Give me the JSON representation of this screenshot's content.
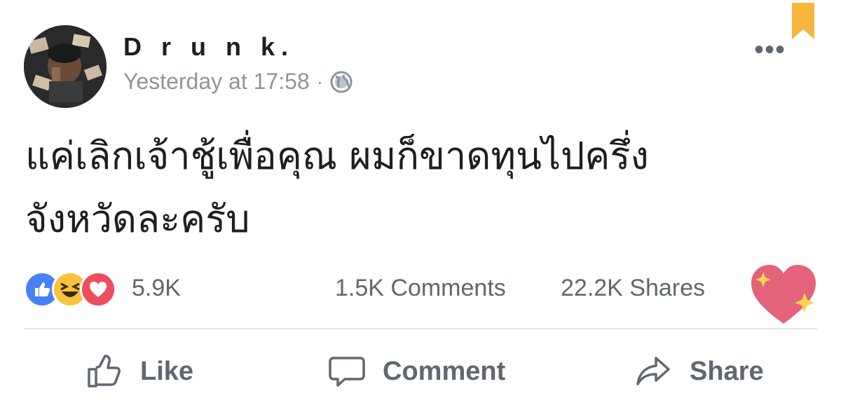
{
  "post": {
    "author": "D r u n k.",
    "timestamp": "Yesterday at 17:58",
    "separator": "·",
    "privacy_icon": "globe-icon",
    "text_lines": [
      "แค่เลิกเจ้าชู้เพื่อคุณ ผมก็ขาดทุนไปครึ่ง",
      "จังหวัดละครับ"
    ]
  },
  "menu": {
    "more_label": "•••"
  },
  "stats": {
    "reaction_icons": [
      "like-icon",
      "haha-icon",
      "love-icon"
    ],
    "reactions_count": "5.9K",
    "comments": "1.5K Comments",
    "shares": "22.2K Shares"
  },
  "actions": {
    "like": "Like",
    "comment": "Comment",
    "share": "Share"
  },
  "colors": {
    "like_blue": "#4a80f5",
    "love_red": "#ee4d5f",
    "haha_yellow": "#f7c33c",
    "bookmark_orange": "#f6b73c",
    "muted_text": "#606770"
  }
}
